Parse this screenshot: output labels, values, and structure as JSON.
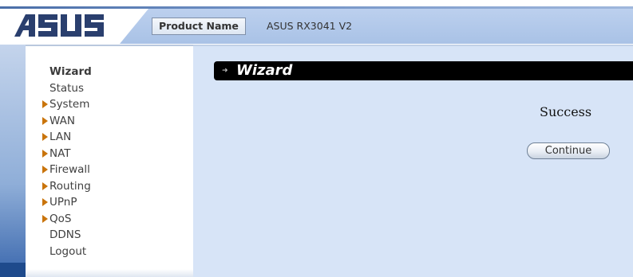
{
  "brand": {
    "logo_text": "ASUS"
  },
  "header": {
    "product_label": "Product Name",
    "product_value": "ASUS RX3041 V2"
  },
  "sidebar": {
    "items": [
      {
        "label": "Wizard",
        "bold": true,
        "expandable": false
      },
      {
        "label": "Status",
        "bold": false,
        "expandable": false
      },
      {
        "label": "System",
        "bold": false,
        "expandable": true
      },
      {
        "label": "WAN",
        "bold": false,
        "expandable": true
      },
      {
        "label": "LAN",
        "bold": false,
        "expandable": true
      },
      {
        "label": "NAT",
        "bold": false,
        "expandable": true
      },
      {
        "label": "Firewall",
        "bold": false,
        "expandable": true
      },
      {
        "label": "Routing",
        "bold": false,
        "expandable": true
      },
      {
        "label": "UPnP",
        "bold": false,
        "expandable": true
      },
      {
        "label": "QoS",
        "bold": false,
        "expandable": true
      },
      {
        "label": "DDNS",
        "bold": false,
        "expandable": false
      },
      {
        "label": "Logout",
        "bold": false,
        "expandable": false
      }
    ]
  },
  "main": {
    "title": "Wizard",
    "message": "Success",
    "continue_label": "Continue"
  },
  "colors": {
    "accent_blue": "#a9c2e6",
    "content_bg": "#d7e4f7",
    "title_bar": "#000000",
    "nav_arrow": "#c9740b"
  }
}
